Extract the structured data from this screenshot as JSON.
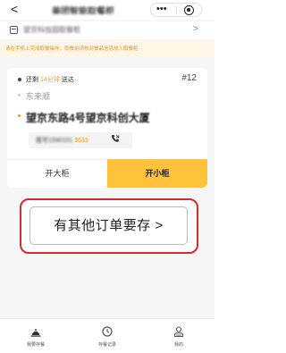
{
  "nav": {
    "back_glyph": "<",
    "title": "美团智能取餐柜",
    "more_glyph": "•••"
  },
  "location": {
    "name": "望京科技园取餐柜",
    "chevron": ">"
  },
  "notice": {
    "text": "请在手机上完成取餐操作，取餐前请核对餐品信息放入取餐柜"
  },
  "order": {
    "status_prefix": "还剩",
    "status_time": "14分钟",
    "status_suffix": "送达",
    "order_no": "#12",
    "from": "东来顺",
    "to": "望京东路4号望京科创大厦",
    "phone_masked": "尾号1590101",
    "phone_tail": "3633",
    "open_large": "开大柜",
    "open_small": "开小柜"
  },
  "more_orders": {
    "label": "有其他订单要存 >"
  },
  "tabs": [
    {
      "label": "我要存餐",
      "icon": "locker-icon"
    },
    {
      "label": "存餐记录",
      "icon": "clock-icon"
    },
    {
      "label": "我的",
      "icon": "user-icon"
    }
  ],
  "colors": {
    "accent": "#ffc23a",
    "highlight": "#f0a020",
    "annotation_red": "#d62b2b",
    "notice_bg": "#fff6e6"
  }
}
